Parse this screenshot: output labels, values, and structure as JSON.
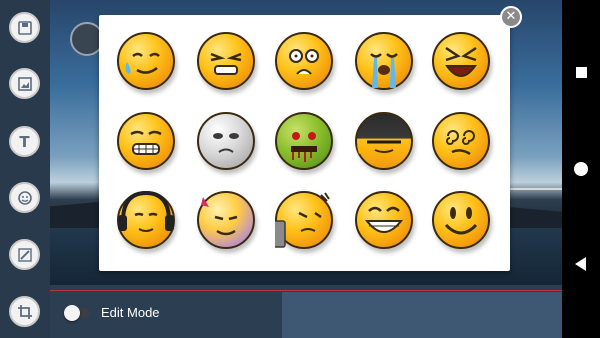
{
  "editor": {
    "edit_mode_label": "Edit Mode",
    "edit_mode_on": false
  },
  "toolbar": {
    "tools": [
      {
        "name": "save-button",
        "icon": "floppy-disk-icon"
      },
      {
        "name": "image-button",
        "icon": "picture-icon"
      },
      {
        "name": "text-button",
        "icon": "text-icon",
        "glyph": "T"
      },
      {
        "name": "emoji-button",
        "icon": "smiley-icon"
      },
      {
        "name": "draw-button",
        "icon": "pencil-icon"
      },
      {
        "name": "crop-button",
        "icon": "crop-icon"
      }
    ]
  },
  "emoji_picker": {
    "close_glyph": "✕",
    "emojis": [
      "sweat-smile-emoji",
      "grin-squint-emoji",
      "shocked-emoji",
      "crying-emoji",
      "laughing-emoji",
      "grimace-emoji",
      "skull-face-emoji",
      "zombie-emoji",
      "helmet-emoji",
      "dizzy-emoji",
      "headphones-emoji",
      "devil-emoji",
      "tombstone-emoji",
      "big-grin-emoji",
      "smile-emoji"
    ]
  },
  "system_nav": [
    "recent-apps-button",
    "home-button",
    "back-button"
  ]
}
